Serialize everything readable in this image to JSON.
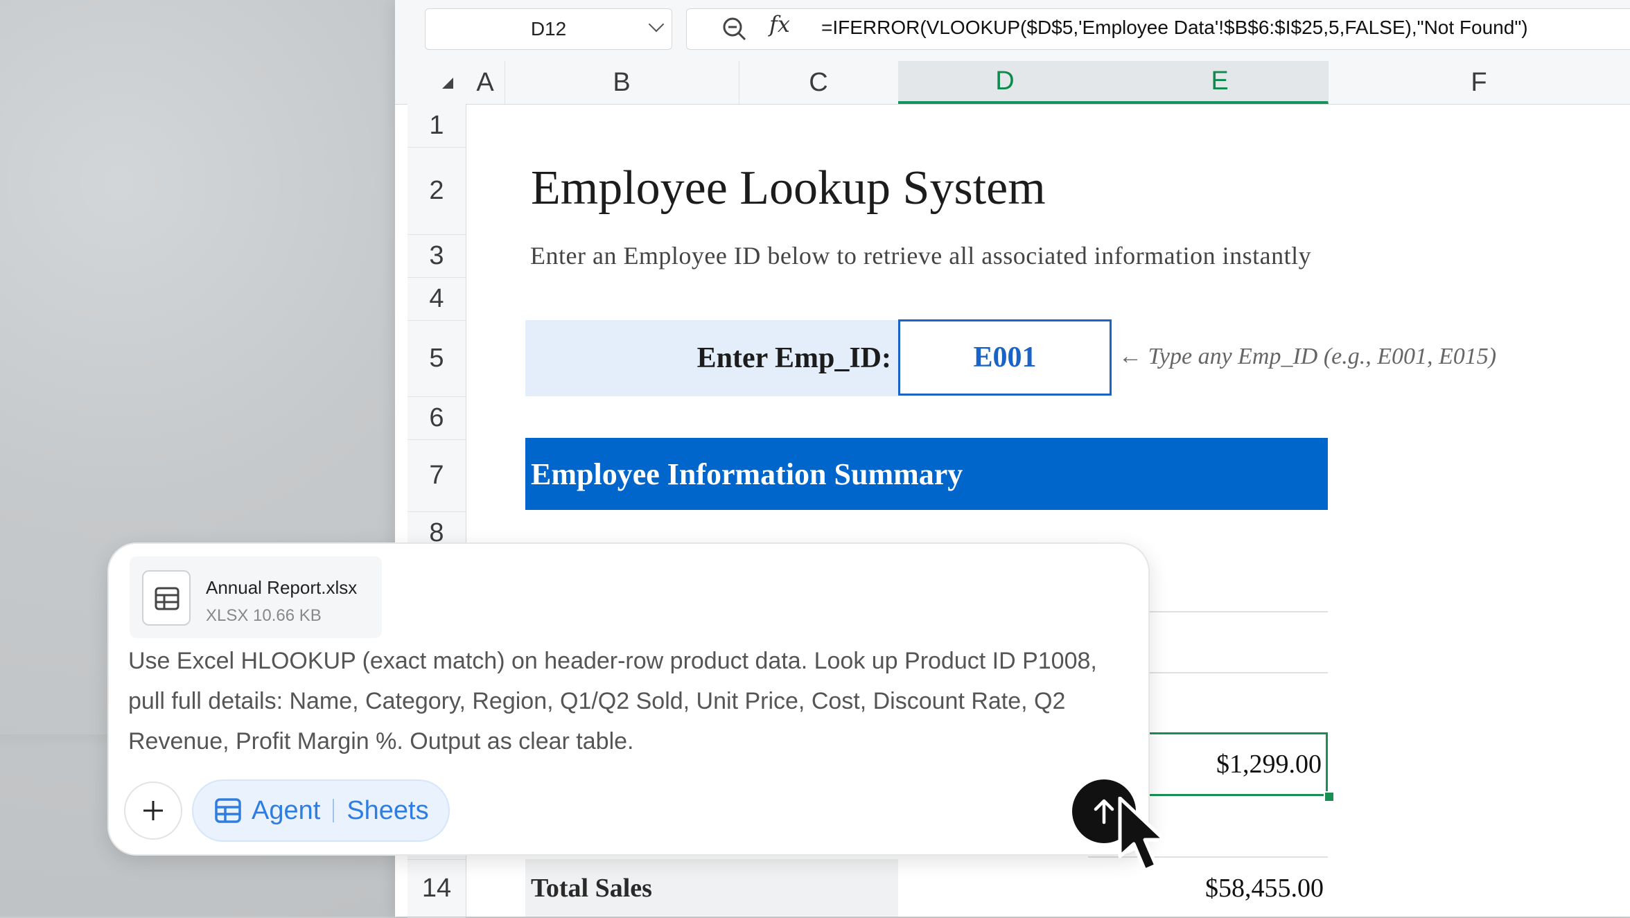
{
  "formula_bar": {
    "cell_ref": "D12",
    "fx_label": "fx",
    "formula": "=IFERROR(VLOOKUP($D$5,'Employee Data'!$B$6:$I$25,5,FALSE),\"Not Found\")"
  },
  "columns": [
    "A",
    "B",
    "C",
    "D",
    "E",
    "F"
  ],
  "rows": [
    "1",
    "2",
    "3",
    "4",
    "5",
    "6",
    "7",
    "8",
    "14"
  ],
  "sheet": {
    "title": "Employee Lookup System",
    "subtitle": "Enter an Employee ID below to retrieve all associated information instantly",
    "emp_label": "Enter Emp_ID:",
    "emp_value": "E001",
    "hint": "← Type any Emp_ID (e.g., E001, E015)",
    "summary_header": "Employee Information Summary",
    "selected_value": "$1,299.00",
    "total_label": "Total Sales",
    "total_value": "$58,455.00"
  },
  "chat": {
    "attachment_name": "Annual Report.xlsx",
    "attachment_meta": "XLSX 10.66 KB",
    "prompt": "Use Excel HLOOKUP (exact match) on header-row product data. Look up Product ID P1008, pull full details: Name, Category, Region, Q1/Q2 Sold, Unit Price, Cost, Discount Rate, Q2 Revenue, Profit Margin %. Output as clear table.",
    "agent_label": "Agent",
    "sheets_label": "Sheets"
  },
  "colors": {
    "accent_blue": "#0066cc",
    "selection_green": "#1a8f55",
    "input_blue": "#1a63c6"
  }
}
